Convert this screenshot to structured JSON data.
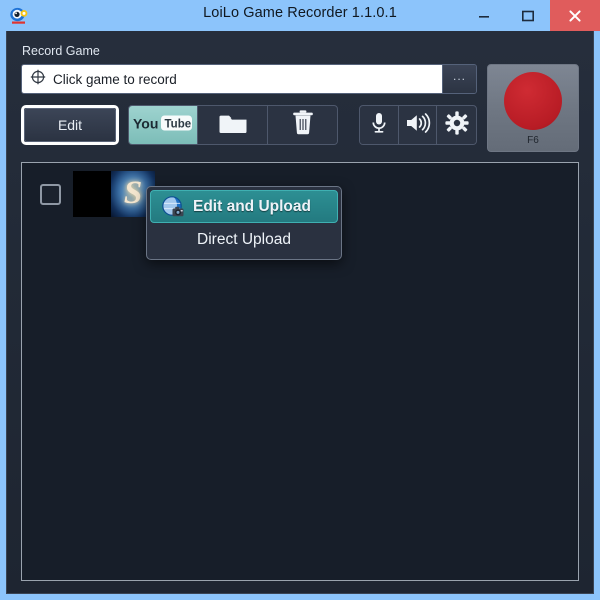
{
  "window": {
    "title": "LoiLo Game Recorder 1.1.0.1",
    "app_icon": "loilo-app-icon",
    "controls": {
      "minimize": "minimize-icon",
      "maximize": "maximize-icon",
      "close": "close-icon"
    },
    "colors": {
      "titlebar": "#8cc4fb",
      "panel": "#242c3a",
      "list_background": "#171e29",
      "accent_teal": "#7cbdb8",
      "menu_highlight": "#237a80",
      "record_red": "#b81c25"
    }
  },
  "record_section": {
    "label": "Record Game",
    "input": {
      "value": "Click game to record",
      "placeholder": "Click game to record",
      "icon": "crosshair-target-icon"
    },
    "browse_button_label": "...",
    "record_button": {
      "hotkey_label": "F6",
      "icon": "record-dot-icon"
    }
  },
  "toolbar": {
    "edit_label": "Edit",
    "buttons": [
      {
        "name": "youtube",
        "icon": "youtube-icon",
        "label_you": "You",
        "label_tube": "Tube",
        "active": true
      },
      {
        "name": "folder",
        "icon": "folder-icon",
        "label": ""
      },
      {
        "name": "delete",
        "icon": "trash-icon",
        "label": ""
      }
    ],
    "device_buttons": [
      {
        "name": "microphone",
        "icon": "microphone-icon"
      },
      {
        "name": "volume",
        "icon": "speaker-volume-icon"
      },
      {
        "name": "settings",
        "icon": "gear-icon"
      }
    ]
  },
  "upload_menu": {
    "items": [
      {
        "label": "Edit and Upload",
        "icon": "globe-camera-icon",
        "highlighted": true
      },
      {
        "label": "Direct Upload",
        "icon": "",
        "highlighted": false
      }
    ]
  },
  "recording_list": {
    "rows": [
      {
        "checked": false,
        "thumbnail_glyph": "S",
        "thumbnail_name": "game-thumbnail"
      }
    ]
  }
}
